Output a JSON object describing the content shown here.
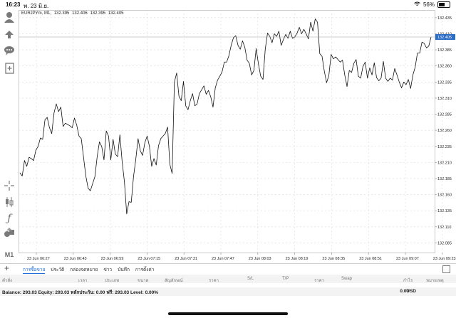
{
  "status_bar": {
    "time": "16:23",
    "date": "พ. 23 มิ.ย.",
    "battery": "56%",
    "battery_level": 0.56
  },
  "chart_header": {
    "symbol": "EURJPYm, M1,",
    "ohlc": [
      "132.395",
      "132.406",
      "132.395",
      "132.405"
    ]
  },
  "left_toolbar": {
    "icons": [
      "account-icon",
      "trade-icon",
      "chat-icon",
      "add-document-icon",
      "crosshair-icon",
      "indicators-icon",
      "function-icon",
      "objects-icon"
    ],
    "timeframe": "M1"
  },
  "bottom_tabs": {
    "items": [
      "การซื้อขาย",
      "ประวัติ",
      "กล่องจดหมาย",
      "ข่าว",
      "บันทึก",
      "การตั้งค่า"
    ],
    "active": 0
  },
  "positions_header": [
    "คำสั่ง",
    "เวลา",
    "ประเภท",
    "ขนาด",
    "สัญลักษณ์",
    "ราคา",
    "S/L",
    "T/P",
    "ราคา",
    "Swap",
    "กำไร",
    "หมายเหตุ"
  ],
  "balance_line": {
    "text": "Balance: 293.03 Equity: 293.03 หลักประกัน: 0.00 ฟรี: 293.03 Level: 0.00%",
    "amount": "0.00",
    "currency": "USD"
  },
  "chart_data": {
    "type": "line",
    "symbol": "EURJPYm",
    "timeframe": "M1",
    "ylim": [
      132.07,
      132.447
    ],
    "y_ticks": [
      "132.435",
      "132.410",
      "132.385",
      "132.360",
      "132.335",
      "132.310",
      "132.285",
      "132.260",
      "132.235",
      "132.210",
      "132.185",
      "132.160",
      "132.135",
      "132.110",
      "132.085"
    ],
    "current_price": "132.405",
    "x_tick_labels": [
      "23 Jun 06:27",
      "23 Jun 06:43",
      "23 Jun 06:59",
      "23 Jun 07:15",
      "23 Jun 07:31",
      "23 Jun 07:47",
      "23 Jun 08:03",
      "23 Jun 08:19",
      "23 Jun 08:35",
      "23 Jun 08:51",
      "23 Jun 09:07",
      "23 Jun 09:23"
    ],
    "grid": true,
    "values": [
      132.194,
      132.189,
      132.213,
      132.204,
      132.218,
      132.216,
      132.213,
      132.229,
      132.235,
      132.248,
      132.246,
      132.276,
      132.28,
      132.264,
      132.255,
      132.287,
      132.301,
      132.289,
      132.296,
      132.266,
      132.271,
      132.269,
      132.267,
      132.264,
      132.279,
      132.268,
      132.251,
      132.247,
      132.218,
      132.189,
      132.17,
      132.166,
      132.177,
      132.188,
      132.219,
      132.242,
      132.235,
      132.214,
      132.259,
      132.251,
      132.214,
      132.246,
      132.223,
      132.219,
      132.253,
      132.211,
      132.18,
      132.13,
      132.149,
      132.148,
      132.188,
      132.215,
      132.247,
      132.228,
      132.221,
      132.241,
      132.251,
      132.235,
      132.204,
      132.216,
      132.206,
      132.236,
      132.247,
      132.251,
      132.255,
      132.265,
      132.207,
      132.193,
      132.335,
      132.349,
      132.313,
      132.306,
      132.336,
      132.298,
      132.292,
      132.306,
      132.317,
      132.298,
      132.301,
      132.317,
      132.323,
      132.329,
      132.316,
      132.322,
      132.312,
      132.296,
      132.326,
      132.338,
      132.344,
      132.351,
      132.366,
      132.366,
      132.376,
      132.392,
      132.404,
      132.407,
      132.392,
      132.386,
      132.399,
      132.389,
      132.369,
      132.364,
      132.346,
      132.353,
      132.387,
      132.363,
      132.344,
      132.339,
      132.386,
      132.411,
      132.406,
      132.396,
      132.41,
      132.406,
      132.414,
      132.392,
      132.401,
      132.409,
      132.403,
      132.414,
      132.403,
      132.405,
      132.411,
      132.42,
      132.41,
      132.417,
      132.41,
      132.402,
      132.428,
      132.414,
      132.433,
      132.428,
      132.379,
      132.375,
      132.352,
      132.334,
      132.345,
      132.378,
      132.371,
      132.374,
      132.37,
      132.366,
      132.369,
      132.346,
      132.328,
      132.353,
      132.35,
      132.364,
      132.37,
      132.344,
      132.341,
      132.359,
      132.366,
      132.341,
      132.357,
      132.346,
      132.365,
      132.342,
      132.337,
      132.341,
      132.367,
      132.341,
      132.336,
      132.341,
      132.338,
      132.356,
      132.346,
      132.335,
      132.326,
      132.335,
      132.331,
      132.339,
      132.325,
      132.346,
      132.358,
      132.38,
      132.38,
      132.397,
      132.395,
      132.388,
      132.391,
      132.405
    ]
  }
}
